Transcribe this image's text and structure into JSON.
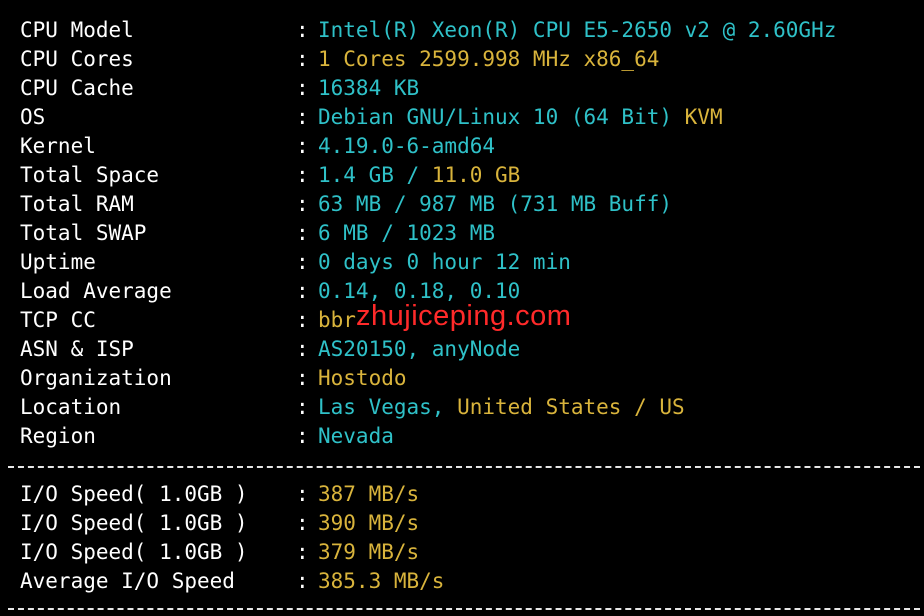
{
  "system_info": [
    {
      "label": "CPU Model",
      "segments": [
        {
          "text": "Intel(R) Xeon(R) CPU E5-2650 v2 @ 2.60GHz",
          "color": "cyan"
        }
      ]
    },
    {
      "label": "CPU Cores",
      "segments": [
        {
          "text": "1 Cores 2599.998 MHz x86_64",
          "color": "yellow"
        }
      ]
    },
    {
      "label": "CPU Cache",
      "segments": [
        {
          "text": "16384 KB",
          "color": "cyan"
        }
      ]
    },
    {
      "label": "OS",
      "segments": [
        {
          "text": "Debian GNU/Linux 10 (64 Bit)",
          "color": "cyan"
        },
        {
          "text": " ",
          "color": "white"
        },
        {
          "text": "KVM",
          "color": "yellow"
        }
      ]
    },
    {
      "label": "Kernel",
      "segments": [
        {
          "text": "4.19.0-6-amd64",
          "color": "cyan"
        }
      ]
    },
    {
      "label": "Total Space",
      "segments": [
        {
          "text": "1.4 GB",
          "color": "cyan"
        },
        {
          "text": " / ",
          "color": "cyan"
        },
        {
          "text": "11.0 GB",
          "color": "yellow"
        }
      ]
    },
    {
      "label": "Total RAM",
      "segments": [
        {
          "text": "63 MB / 987 MB (731 MB Buff)",
          "color": "cyan"
        }
      ]
    },
    {
      "label": "Total SWAP",
      "segments": [
        {
          "text": "6 MB / 1023 MB",
          "color": "cyan"
        }
      ]
    },
    {
      "label": "Uptime",
      "segments": [
        {
          "text": "0 days 0 hour 12 min",
          "color": "cyan"
        }
      ]
    },
    {
      "label": "Load Average",
      "segments": [
        {
          "text": "0.14, 0.18, 0.10",
          "color": "cyan"
        }
      ]
    },
    {
      "label": "TCP CC",
      "segments": [
        {
          "text": "bbr",
          "color": "yellow"
        }
      ]
    },
    {
      "label": "ASN & ISP",
      "segments": [
        {
          "text": "AS20150, anyNode",
          "color": "cyan"
        }
      ]
    },
    {
      "label": "Organization",
      "segments": [
        {
          "text": "Hostodo",
          "color": "yellow"
        }
      ]
    },
    {
      "label": "Location",
      "segments": [
        {
          "text": "Las Vegas,",
          "color": "cyan"
        },
        {
          "text": " ",
          "color": "white"
        },
        {
          "text": "United States / US",
          "color": "yellow"
        }
      ]
    },
    {
      "label": "Region",
      "segments": [
        {
          "text": "Nevada",
          "color": "cyan"
        }
      ]
    }
  ],
  "io_info": [
    {
      "label": "I/O Speed( 1.0GB )",
      "segments": [
        {
          "text": "387 MB/s",
          "color": "yellow"
        }
      ]
    },
    {
      "label": "I/O Speed( 1.0GB )",
      "segments": [
        {
          "text": "390 MB/s",
          "color": "yellow"
        }
      ]
    },
    {
      "label": "I/O Speed( 1.0GB )",
      "segments": [
        {
          "text": "379 MB/s",
          "color": "yellow"
        }
      ]
    },
    {
      "label": "Average I/O Speed",
      "segments": [
        {
          "text": "385.3 MB/s",
          "color": "yellow"
        }
      ]
    }
  ],
  "separator": ":",
  "watermark": "zhujiceping.com",
  "colors": {
    "background": "#000000",
    "cyan": "#2fc1c8",
    "yellow": "#d9b43c",
    "label": "#ffffff",
    "watermark": "#ff2a2a"
  }
}
